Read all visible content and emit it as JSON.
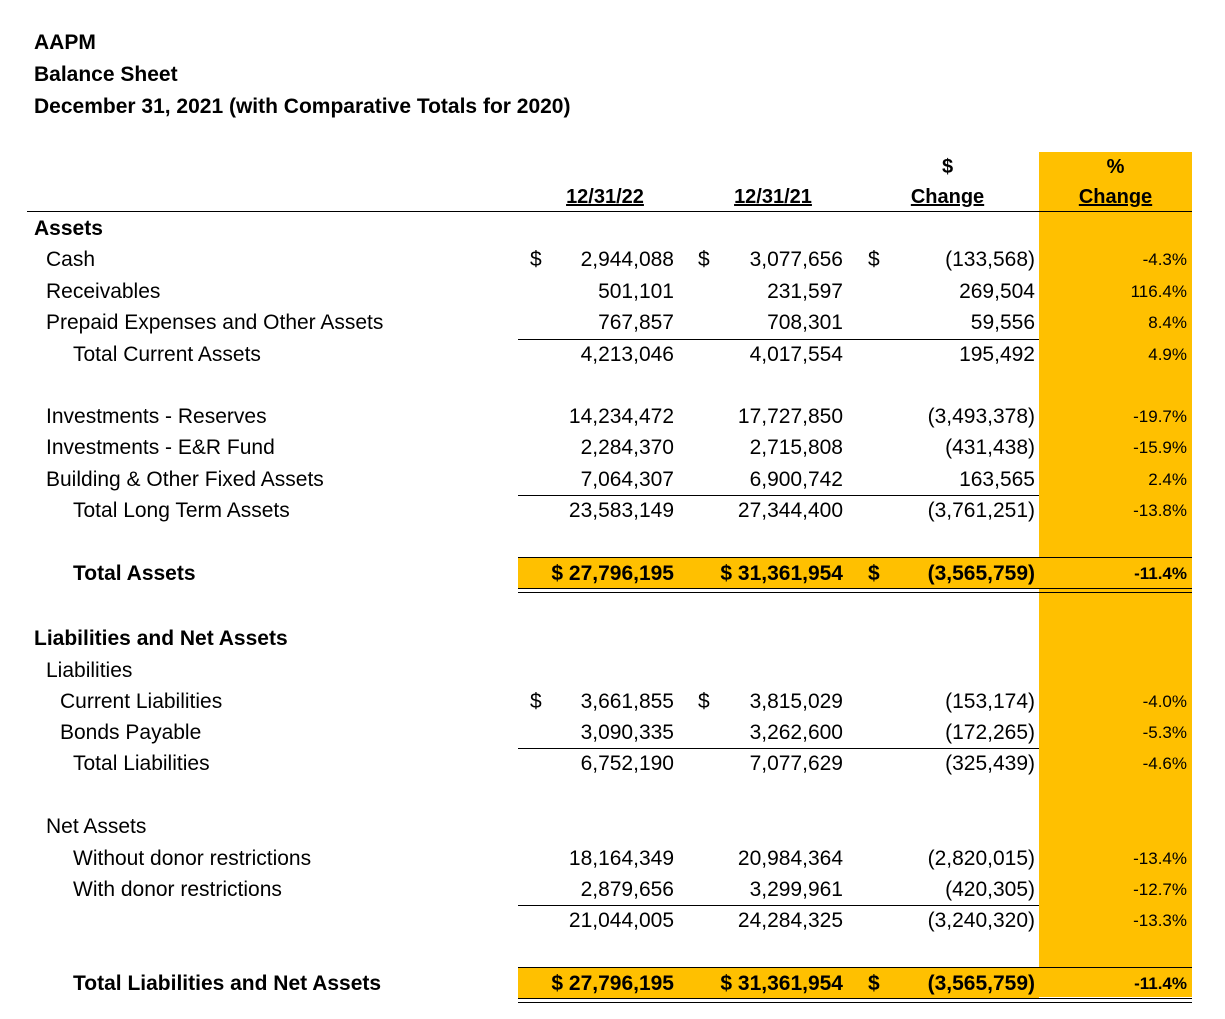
{
  "header": {
    "org": "AAPM",
    "title": "Balance Sheet",
    "subtitle": "December 31, 2021 (with Comparative Totals for 2020)"
  },
  "columns": {
    "col1": "12/31/22",
    "col2": "12/31/21",
    "col3_top": "$",
    "col3": "Change",
    "col4_top": "%",
    "col4": "Change"
  },
  "currency_symbol": "$",
  "accent_color": "#ffc000",
  "sections": {
    "assets": "Assets",
    "liab_net": "Liabilities and Net Assets",
    "liabilities": "Liabilities",
    "net_assets": "Net Assets"
  },
  "rows": {
    "cash": {
      "label": "Cash",
      "v1": "2,944,088",
      "v2": "3,077,656",
      "v3": "(133,568)",
      "pct": "-4.3%"
    },
    "receivables": {
      "label": "Receivables",
      "v1": "501,101",
      "v2": "231,597",
      "v3": "269,504",
      "pct": "116.4%"
    },
    "prepaid": {
      "label": "Prepaid Expenses and Other Assets",
      "v1": "767,857",
      "v2": "708,301",
      "v3": "59,556",
      "pct": "8.4%"
    },
    "total_current": {
      "label": "Total Current Assets",
      "v1": "4,213,046",
      "v2": "4,017,554",
      "v3": "195,492",
      "pct": "4.9%"
    },
    "inv_reserves": {
      "label": "Investments - Reserves",
      "v1": "14,234,472",
      "v2": "17,727,850",
      "v3": "(3,493,378)",
      "pct": "-19.7%"
    },
    "inv_er": {
      "label": "Investments - E&R Fund",
      "v1": "2,284,370",
      "v2": "2,715,808",
      "v3": "(431,438)",
      "pct": "-15.9%"
    },
    "building": {
      "label": "Building & Other Fixed Assets",
      "v1": "7,064,307",
      "v2": "6,900,742",
      "v3": "163,565",
      "pct": "2.4%"
    },
    "total_lt": {
      "label": "Total Long Term Assets",
      "v1": "23,583,149",
      "v2": "27,344,400",
      "v3": "(3,761,251)",
      "pct": "-13.8%"
    },
    "total_assets": {
      "label": "Total Assets",
      "v1": "$ 27,796,195",
      "v2": "$ 31,361,954",
      "v3": "(3,565,759)",
      "pct": "-11.4%"
    },
    "current_liab": {
      "label": "Current Liabilities",
      "v1": "3,661,855",
      "v2": "3,815,029",
      "v3": "(153,174)",
      "pct": "-4.0%"
    },
    "bonds": {
      "label": "Bonds Payable",
      "v1": "3,090,335",
      "v2": "3,262,600",
      "v3": "(172,265)",
      "pct": "-5.3%"
    },
    "total_liab": {
      "label": "Total Liabilities",
      "v1": "6,752,190",
      "v2": "7,077,629",
      "v3": "(325,439)",
      "pct": "-4.6%"
    },
    "without_donor": {
      "label": "Without donor restrictions",
      "v1": "18,164,349",
      "v2": "20,984,364",
      "v3": "(2,820,015)",
      "pct": "-13.4%"
    },
    "with_donor": {
      "label": "With donor restrictions",
      "v1": "2,879,656",
      "v2": "3,299,961",
      "v3": "(420,305)",
      "pct": "-12.7%"
    },
    "net_total": {
      "label": "",
      "v1": "21,044,005",
      "v2": "24,284,325",
      "v3": "(3,240,320)",
      "pct": "-13.3%"
    },
    "total_liab_net": {
      "label": "Total Liabilities and Net Assets",
      "v1": "$ 27,796,195",
      "v2": "$ 31,361,954",
      "v3": "(3,565,759)",
      "pct": "-11.4%"
    }
  }
}
